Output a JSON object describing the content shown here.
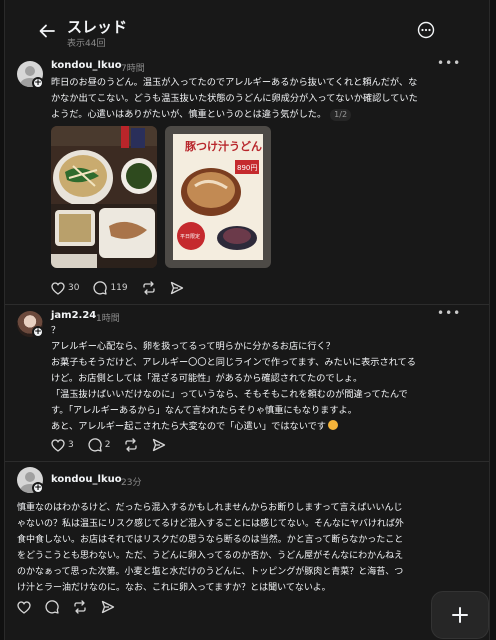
{
  "header": {
    "title": "スレッド",
    "views": "表示44回"
  },
  "posts": [
    {
      "username": "kondou_lkuo",
      "time": "7時間",
      "lines": [
        "昨日のお昼のうどん。温玉が入ってたのでアレルギーあるから抜いてくれと頼んだが、な",
        "かなか出てこない。どうも温玉抜いた状態のうどんに卵成分が入ってないか確認していた",
        "ようだ。心遣いはありがたいが、慎重というのとは違う気がした。"
      ],
      "image_counter": "1/2",
      "menu_text": {
        "top": "豚つけ汁うどん",
        "price": "890円",
        "badge": "平日限定"
      },
      "likes": "30",
      "comments": "119"
    },
    {
      "username": "jam2.24",
      "time": "1時間",
      "lines": [
        "？",
        "アレルギー心配なら、卵を扱ってるって明らかに分かるお店に行く？",
        "お菓子もそうだけど、アレルギー〇〇と同じラインで作ってます、みたいに表示されてる",
        "けど。お店側としては「混ざる可能性」があるから確認されてたのでしょ。",
        "「温玉抜けばいいだけなのに」っていうなら、そもそもこれを頼むのが間違ってたんで",
        "す。「アレルギーあるから」なんて言われたらそりゃ慎重にもなりますよ。",
        "あと、アレルギー起こされたら大変なので「心遣い」ではないです"
      ],
      "likes": "3",
      "comments": "2"
    },
    {
      "username": "kondou_lkuo",
      "time": "23分",
      "lines": [
        "慎重なのはわかるけど、だったら混入するかもしれませんからお断りしますって言えばいいんじ",
        "ゃないの？私は温玉にリスク感じてるけど混入することには感じてない。そんなにヤバければ外",
        "食中食しない。お店はそれではリスクだの思うなら断るのは当然。かと言って断らなかったこと",
        "をどうこうとも思わない。ただ、うどんに卵入ってるのか否か、うどん屋がそんなにわかんねえ",
        "のかなぁって思った次第。小麦と塩と水だけのうどんに、トッピングが豚肉と青菜？と海苔、つ",
        "け汁とラー油だけなのに。なお、これに卵入ってますか？とは聞いてないよ。"
      ]
    }
  ]
}
